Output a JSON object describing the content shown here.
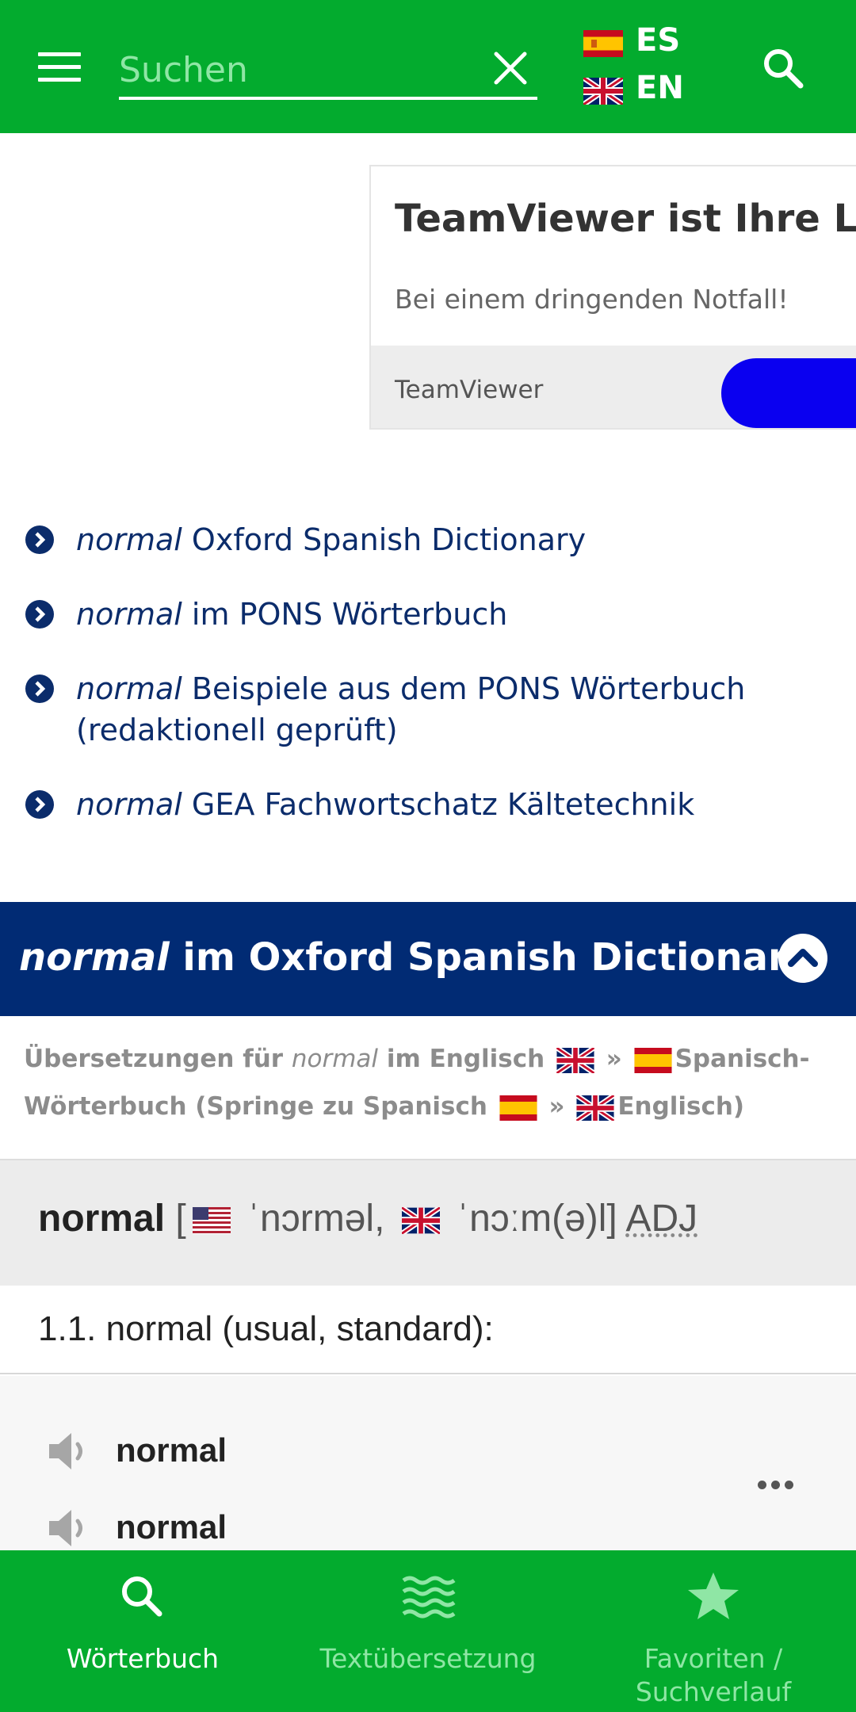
{
  "colors": {
    "brand_green": "#03ab2e",
    "dark_blue": "#012b74",
    "link_blue": "#0b2c6b",
    "muted_green": "#8fe6a5"
  },
  "header": {
    "search_placeholder": "Suchen",
    "lang_es": "ES",
    "lang_en": "EN",
    "icons": [
      "menu-icon",
      "close-icon",
      "spain-flag-icon",
      "uk-flag-icon",
      "search-icon"
    ]
  },
  "ad": {
    "title": "TeamViewer ist Ihre Lösu",
    "text": "Bei einem dringenden Notfall!",
    "brand": "TeamViewer"
  },
  "links": [
    {
      "word": "normal",
      "label": "Oxford Spanish Dictionary"
    },
    {
      "word": "normal",
      "label": "im PONS Wörterbuch"
    },
    {
      "word": "normal",
      "label": "Beispiele aus dem PONS Wörterbuch (redaktionell geprüft)"
    },
    {
      "word": "normal",
      "label": "GEA Fachwortschatz Kältetechnik"
    }
  ],
  "section": {
    "word": "normal",
    "title": "im Oxford Spanish Dictionary"
  },
  "info": {
    "part1": "Übersetzungen für",
    "word": "normal",
    "part2": "im Englisch",
    "sep1": "»",
    "part3": "Spanisch-Wörterbuch (Springe zu Spanisch",
    "sep2": "»",
    "part4": "Englisch)"
  },
  "entry": {
    "headword": "normal",
    "open": "[",
    "pron_us": "ˈnɔrməl,",
    "pron_uk": "ˈnɔːm(ə)l]",
    "pos": "ADJ",
    "sense": "1.1. normal (usual, standard):",
    "translations": [
      "normal",
      "normal"
    ]
  },
  "bottom_nav": [
    {
      "label": "Wörterbuch",
      "icon": "search-icon",
      "active": true
    },
    {
      "label": "Textübersetzung",
      "icon": "waves-icon",
      "active": false
    },
    {
      "label": "Favoriten / Suchverlauf",
      "icon": "star-icon",
      "active": false
    }
  ]
}
